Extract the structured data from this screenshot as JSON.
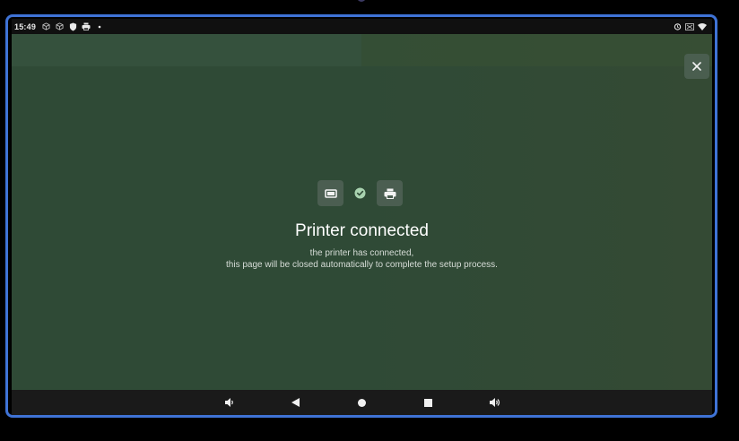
{
  "status_bar": {
    "time": "15:49",
    "left_icons": [
      "cube-icon",
      "cube-icon",
      "shield-icon",
      "printer-icon",
      "dot-icon"
    ],
    "right_icons": [
      "alarm-icon",
      "no-sim-icon",
      "wifi-icon"
    ]
  },
  "dialog": {
    "close_icon": "close-icon",
    "status_icons": [
      "device-icon",
      "check-circle-icon",
      "printer-icon"
    ],
    "title": "Printer connected",
    "message_line1": "the printer has connected,",
    "message_line2": "this page will be closed automatically to complete the setup process."
  },
  "nav_bar": {
    "buttons": [
      "volume-down-icon",
      "back-icon",
      "home-icon",
      "recents-icon",
      "volume-up-icon"
    ]
  },
  "colors": {
    "background": "#2f4a36",
    "frame_border": "#3f73d6",
    "tile": "#4b5e51",
    "check": "#a9d3b0"
  }
}
